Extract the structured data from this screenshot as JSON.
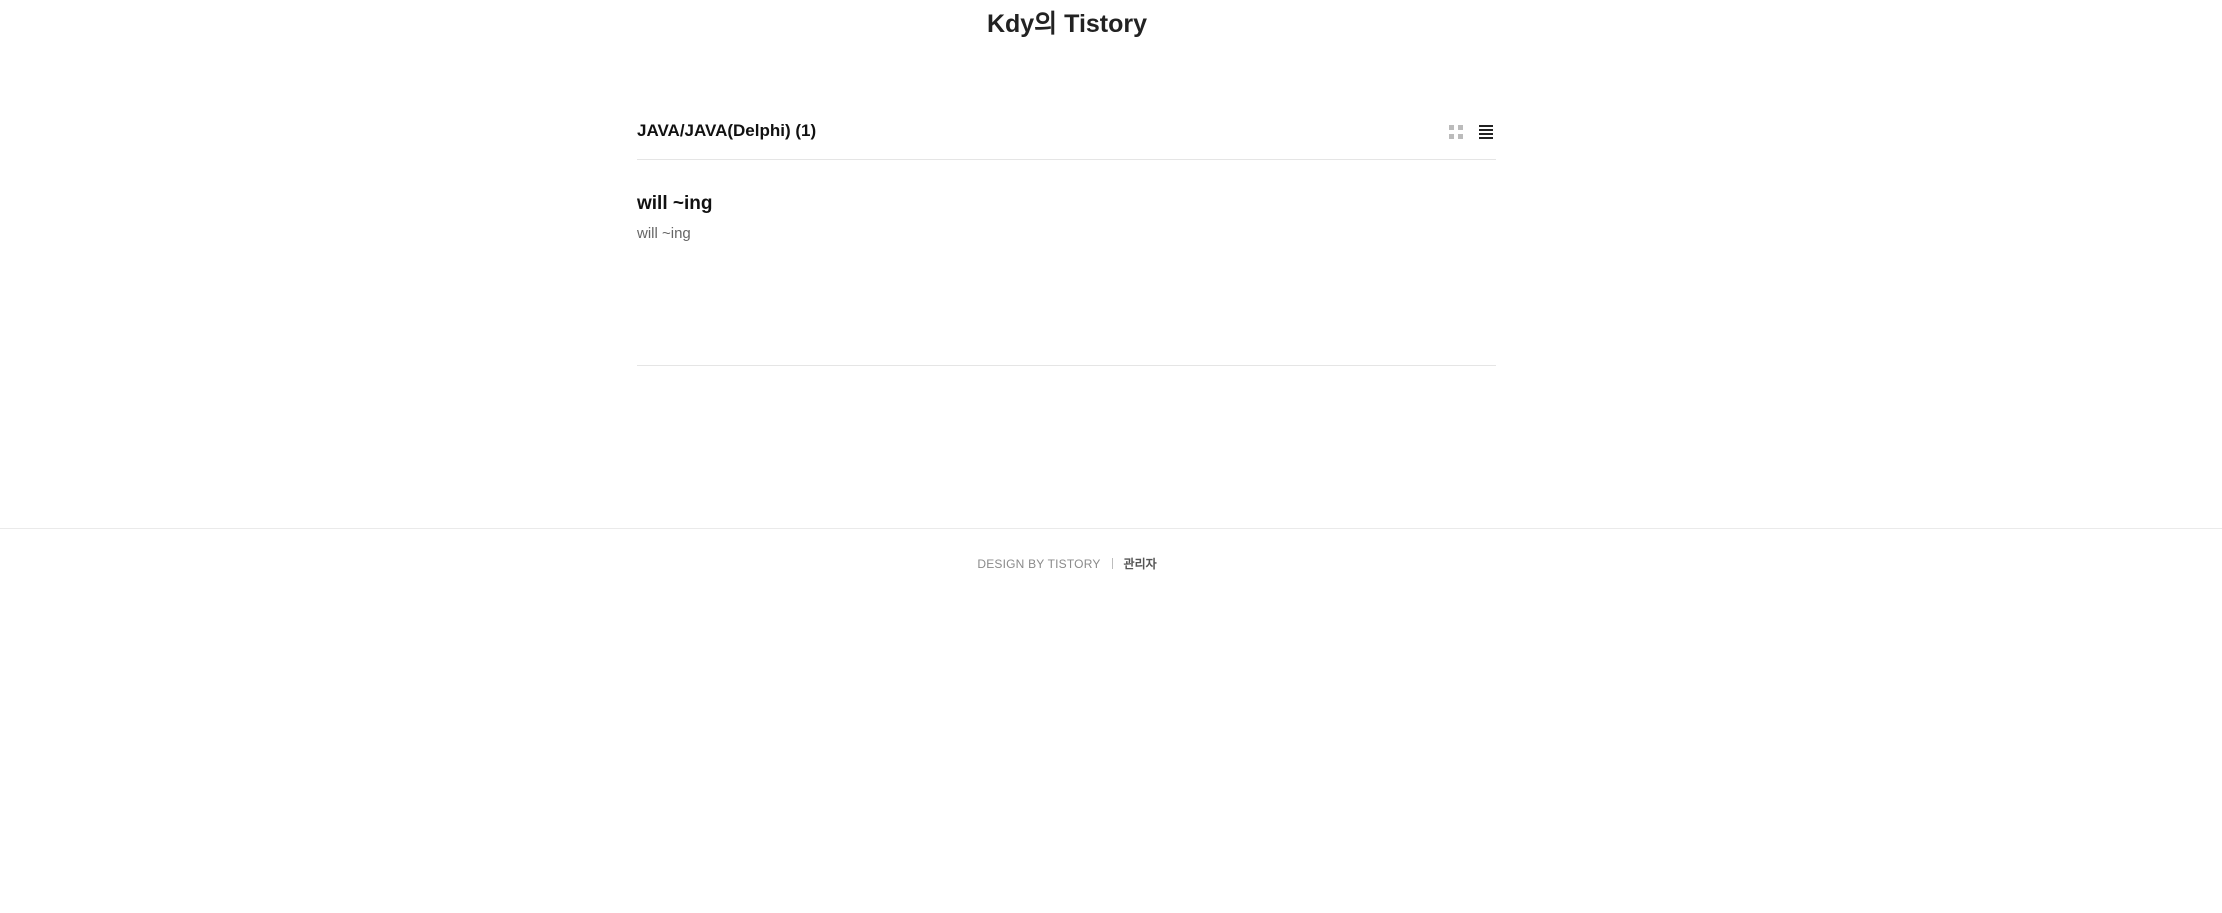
{
  "header": {
    "blog_title": "Kdy의 Tistory"
  },
  "category": {
    "title": "JAVA/JAVA(Delphi) (1)",
    "view_modes": [
      {
        "icon": "grid-view-icon",
        "active": false
      },
      {
        "icon": "list-view-icon",
        "active": true
      }
    ]
  },
  "posts": [
    {
      "title": "will ~ing",
      "summary": "will ~ing"
    }
  ],
  "footer": {
    "design_text": "DESIGN BY TISTORY",
    "admin_label": "관리자"
  },
  "colors": {
    "text": "#222222",
    "muted": "#8a8a8a",
    "divider": "#e5e5e5",
    "inactive_icon": "#bbbbbb"
  }
}
